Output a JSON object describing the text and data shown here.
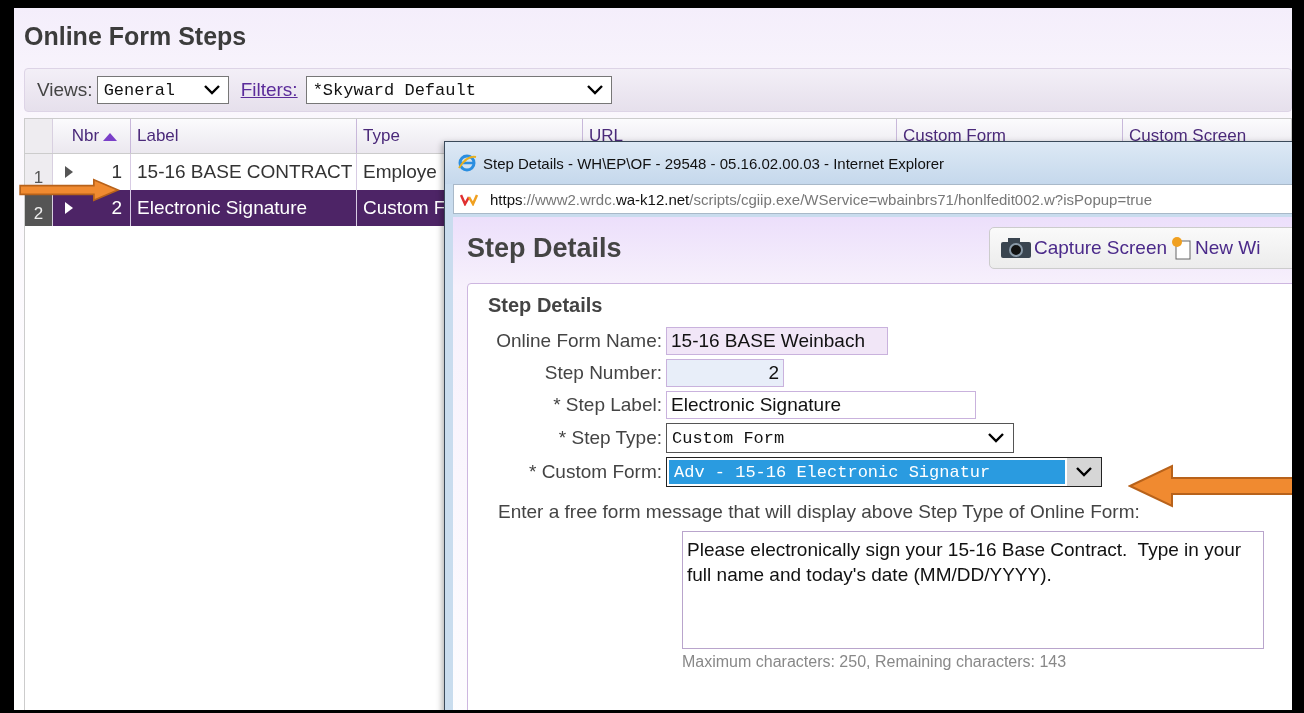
{
  "page": {
    "title": "Online Form Steps"
  },
  "toolbar": {
    "views_label": "Views:",
    "views_value": "General",
    "filters_label": "Filters:",
    "filters_value": "*Skyward Default"
  },
  "table": {
    "columns": [
      {
        "label": "Nbr",
        "sorted": true
      },
      {
        "label": "Label",
        "sorted": false
      },
      {
        "label": "Type",
        "sorted": false
      },
      {
        "label": "URL",
        "sorted": false
      },
      {
        "label": "Custom Form",
        "sorted": false
      },
      {
        "label": "Custom Screen",
        "sorted": false
      }
    ],
    "rows": [
      {
        "index": "1",
        "nbr": "1",
        "label": "15-16 BASE CONTRACT",
        "type": "Employe",
        "selected": false
      },
      {
        "index": "2",
        "nbr": "2",
        "label": "Electronic Signature",
        "type": "Custom F",
        "selected": true
      }
    ]
  },
  "popup": {
    "window_title": "Step Details - WH\\EP\\OF - 29548 - 05.16.02.00.03 - Internet Explorer",
    "url_parts": [
      {
        "text": "https",
        "highlight": true
      },
      {
        "text": "://www2.wrdc.",
        "highlight": false
      },
      {
        "text": "wa-k12.net",
        "highlight": true
      },
      {
        "text": "/scripts/cgiip.exe/WService=wbainbrs71/honlfedit002.w?isPopup=true",
        "highlight": false
      }
    ],
    "heading": "Step Details",
    "buttons": [
      {
        "label": "Capture Screen",
        "kind": "camera"
      },
      {
        "label": "New Wi",
        "kind": "window"
      }
    ],
    "section_title": "Step Details",
    "fields": [
      {
        "label": "Online Form Name:",
        "value": "15-16 BASE Weinbach",
        "kind": "readonly"
      },
      {
        "label": "Step Number:",
        "value": "2",
        "kind": "number"
      },
      {
        "label": "* Step Label:",
        "value": "Electronic Signature",
        "kind": "text"
      },
      {
        "label": "* Step Type:",
        "value": "Custom Form",
        "kind": "select",
        "highlighted": false
      },
      {
        "label": "* Custom Form:",
        "value": "Adv - 15-16 Electronic Signatur",
        "kind": "select",
        "highlighted": true
      }
    ],
    "message_label": "Enter a free form message that will display above Step Type of Online Form:",
    "message_value": "Please electronically sign your 15-16 Base Contract.  Type in your full name and today's date (MM/DD/YYYY).",
    "char_count": "Maximum characters: 250, Remaining characters: 143"
  }
}
